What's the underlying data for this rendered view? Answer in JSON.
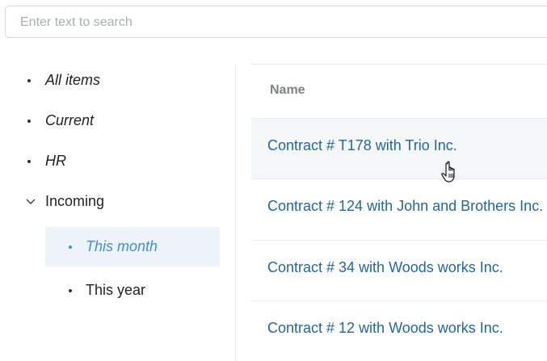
{
  "search": {
    "placeholder": "Enter text to search",
    "value": ""
  },
  "sidebar": {
    "items": [
      {
        "label": "All items"
      },
      {
        "label": "Current"
      },
      {
        "label": "HR"
      },
      {
        "label": "Incoming",
        "expanded": true,
        "children": [
          {
            "label": "This month",
            "selected": true
          },
          {
            "label": "This year"
          }
        ]
      }
    ]
  },
  "table": {
    "columns": [
      "Name"
    ],
    "rows": [
      {
        "name": "Contract # T178 with Trio Inc.",
        "hovered": true
      },
      {
        "name": "Contract # 124 with John and Brothers Inc."
      },
      {
        "name": "Contract # 34 with Woods works Inc."
      },
      {
        "name": "Contract # 12 with Woods works Inc."
      }
    ]
  },
  "colors": {
    "link": "#2166a7",
    "selected_bg": "#eef3fb",
    "selected_text": "#3a8fd9",
    "hover_row": "#f5f6f7"
  }
}
